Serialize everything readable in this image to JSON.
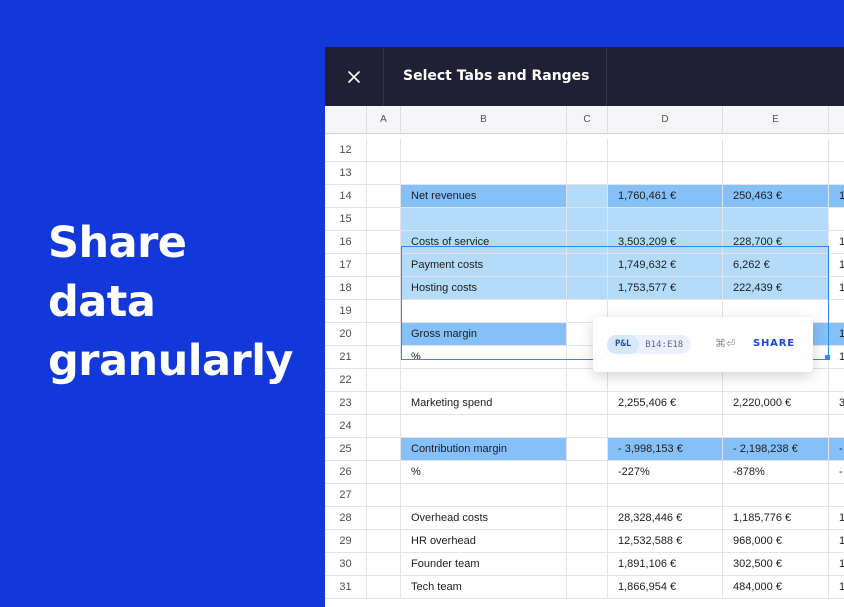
{
  "headline": [
    "Share",
    "data",
    "granularly"
  ],
  "dialog": {
    "title": "Select Tabs and Ranges",
    "close_icon": "close-icon"
  },
  "columns": [
    "A",
    "B",
    "C",
    "D",
    "E"
  ],
  "rows": [
    {
      "n": "12",
      "b": "",
      "d": "",
      "e": "",
      "f": ""
    },
    {
      "n": "13",
      "b": "",
      "d": "",
      "e": "",
      "f": ""
    },
    {
      "n": "14",
      "b": "Net revenues",
      "d": "1,760,461 €",
      "e": "250,463 €",
      "f": "1"
    },
    {
      "n": "15",
      "b": "",
      "d": "",
      "e": "",
      "f": ""
    },
    {
      "n": "16",
      "b": "Costs of service",
      "d": "3,503,209 €",
      "e": "228,700 €",
      "f": "1"
    },
    {
      "n": "17",
      "b": "Payment costs",
      "d": "1,749,632 €",
      "e": "6,262 €",
      "f": "1"
    },
    {
      "n": "18",
      "b": "Hosting costs",
      "d": "1,753,577 €",
      "e": "222,439 €",
      "f": "1"
    },
    {
      "n": "19",
      "b": "",
      "d": "",
      "e": "",
      "f": ""
    },
    {
      "n": "20",
      "b": "Gross margin",
      "d": "",
      "e": "",
      "f": "1"
    },
    {
      "n": "21",
      "b": "%",
      "d": "",
      "e": "",
      "f": "1"
    },
    {
      "n": "22",
      "b": "",
      "d": "",
      "e": "",
      "f": ""
    },
    {
      "n": "23",
      "b": "Marketing spend",
      "d": "2,255,406 €",
      "e": "2,220,000 €",
      "f": "3"
    },
    {
      "n": "24",
      "b": "",
      "d": "",
      "e": "",
      "f": ""
    },
    {
      "n": "25",
      "b": "Contribution margin",
      "d": "- 3,998,153 €",
      "e": "- 2,198,238 €",
      "f": "-"
    },
    {
      "n": "26",
      "b": "%",
      "d": "-227%",
      "e": "-878%",
      "f": "-"
    },
    {
      "n": "27",
      "b": "",
      "d": "",
      "e": "",
      "f": ""
    },
    {
      "n": "28",
      "b": "Overhead costs",
      "d": "28,328,446 €",
      "e": "1,185,776 €",
      "f": "1"
    },
    {
      "n": "29",
      "b": "HR overhead",
      "d": "12,532,588 €",
      "e": "968,000 €",
      "f": "1"
    },
    {
      "n": "30",
      "b": "Founder team",
      "d": "1,891,106 €",
      "e": "302,500 €",
      "f": "1"
    },
    {
      "n": "31",
      "b": "Tech team",
      "d": "1,866,954 €",
      "e": "484,000 €",
      "f": "1"
    }
  ],
  "popup": {
    "tab": "P&L",
    "range": "B14:E18",
    "shortcut": "⌘⏎",
    "share_label": "SHARE"
  },
  "colors": {
    "background": "#1238d9",
    "titlebar": "#201f33",
    "highlight": "#86c0f9",
    "selection_fill": "#b5dbfb",
    "selection_border": "#2c8be8",
    "share": "#1c46d4"
  }
}
